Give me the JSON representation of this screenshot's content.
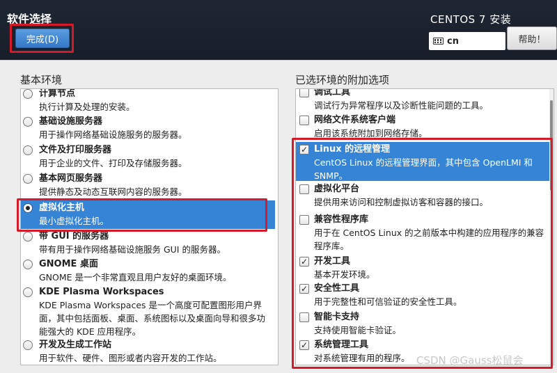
{
  "header": {
    "title": "软件选择",
    "done_label": "完成(D)",
    "install_title": "CENTOS 7 安装",
    "keyboard_layout": "cn",
    "help_label": "帮助！"
  },
  "base_env": {
    "label": "基本环境",
    "items": [
      {
        "title": "计算节点",
        "desc": "执行计算及处理的安装。"
      },
      {
        "title": "基础设施服务器",
        "desc": "用于操作网络基础设施服务的服务器。"
      },
      {
        "title": "文件及打印服务器",
        "desc": "用于企业的文件、打印及存储服务器。"
      },
      {
        "title": "基本网页服务器",
        "desc": "提供静态及动态互联网内容的服务器。"
      },
      {
        "title": "虚拟化主机",
        "desc": "最小虚拟化主机。",
        "selected": true
      },
      {
        "title": "带 GUI 的服务器",
        "desc": "带有用于操作网络基础设施服务 GUI 的服务器。"
      },
      {
        "title": "GNOME 桌面",
        "desc": "GNOME 是一个非常直观且用户友好的桌面环境。"
      },
      {
        "title": "KDE Plasma Workspaces",
        "desc_lines": [
          "KDE Plasma Workspaces 是一个高度可配置图形用户界",
          "面，其中包括面板、桌面、系统图标以及桌面向导和很多功",
          "能强大的 KDE 应用程序。"
        ]
      },
      {
        "title": "开发及生成工作站",
        "desc": "用于软件、硬件、图形或者内容开发的工作站。"
      }
    ]
  },
  "addons": {
    "label": "已选环境的附加选项",
    "items": [
      {
        "title": "调试工具",
        "desc": "调试行为异常程序以及诊断性能问题的工具。",
        "checked": false
      },
      {
        "title": "网络文件系统客户端",
        "desc": "启用该系统附加到网络存储。",
        "checked": false
      },
      {
        "title": "Linux 的远程管理",
        "desc_lines": [
          "CentOS Linux 的远程管理界面，其中包含 OpenLMI 和",
          "SNMP。"
        ],
        "checked": true,
        "selected": true
      },
      {
        "title": "虚拟化平台",
        "desc": "提供用来访问和控制虚拟访客和容器的接口。",
        "checked": false
      },
      {
        "title": "兼容性程序库",
        "desc_lines": [
          "用于在 CentOS Linux 的之前版本中构建的应用程序的兼容",
          "程序库。"
        ],
        "checked": false
      },
      {
        "title": "开发工具",
        "desc": "基本开发环境。",
        "checked": true
      },
      {
        "title": "安全性工具",
        "desc": "用于完整性和可信验证的安全性工具。",
        "checked": true
      },
      {
        "title": "智能卡支持",
        "desc": "支持使用智能卡验证。",
        "checked": false
      },
      {
        "title": "系统管理工具",
        "desc": "对系统管理有用的程序。",
        "checked": true
      }
    ]
  },
  "watermark": "CSDN @Gauss松鼠会",
  "colors": {
    "accent": "#3584d6",
    "highlight_border": "#d51a2a",
    "header_bg": "#1c2330"
  }
}
